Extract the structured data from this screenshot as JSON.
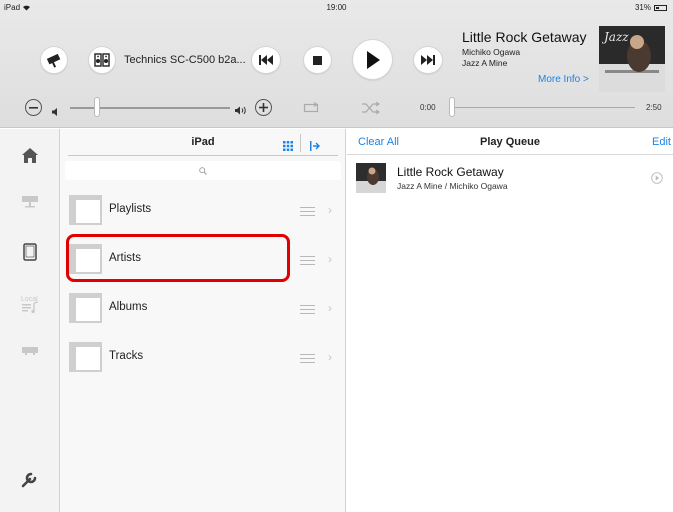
{
  "status_bar": {
    "device": "iPad",
    "time": "19:00",
    "battery": "31%"
  },
  "player": {
    "speaker_name": "Technics SC-C500 b2a...",
    "track_title": "Little Rock Getaway",
    "artist": "Michiko Ogawa",
    "album": "Jazz A Mine",
    "more_info": "More Info >",
    "elapsed": "0:00",
    "duration": "2:50",
    "volume_level": 0.17,
    "seek_position": 0.0,
    "album_art_text": "Jazz"
  },
  "sidebar": {
    "items": [
      {
        "icon": "home-icon"
      },
      {
        "icon": "network-player-icon"
      },
      {
        "icon": "ipad-icon"
      },
      {
        "icon": "local-music-icon",
        "label": "Local"
      },
      {
        "icon": "device-icon"
      },
      {
        "icon": "wrench-icon"
      }
    ]
  },
  "browser": {
    "title": "iPad",
    "items": [
      {
        "label": "Playlists"
      },
      {
        "label": "Artists"
      },
      {
        "label": "Albums"
      },
      {
        "label": "Tracks"
      }
    ]
  },
  "queue": {
    "clear_all": "Clear All",
    "title": "Play Queue",
    "edit": "Edit",
    "items": [
      {
        "title": "Little Rock Getaway",
        "subtitle": "Jazz A Mine / Michiko Ogawa"
      }
    ]
  },
  "colors": {
    "accent": "#1a84e8",
    "highlight": "#e00000"
  }
}
